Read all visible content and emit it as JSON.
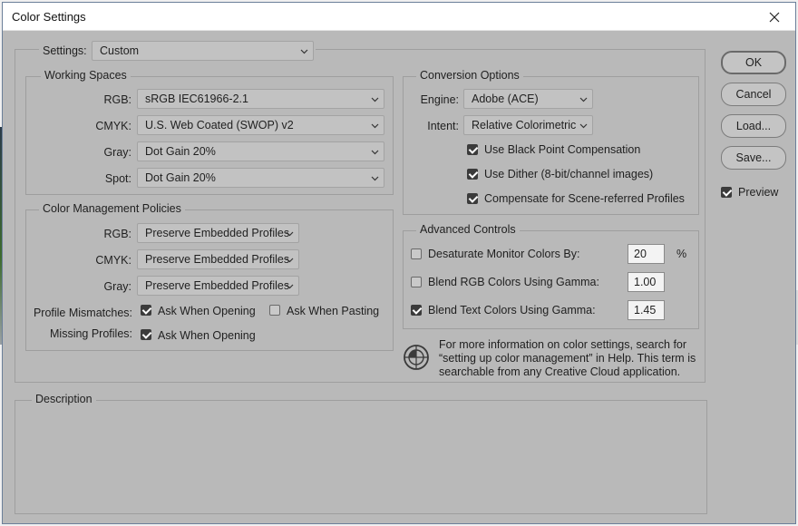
{
  "window": {
    "title": "Color Settings"
  },
  "settings": {
    "label": "Settings:",
    "value": "Custom"
  },
  "working_spaces": {
    "title": "Working Spaces",
    "rows": [
      {
        "label": "RGB:",
        "value": "sRGB IEC61966-2.1"
      },
      {
        "label": "CMYK:",
        "value": "U.S. Web Coated (SWOP) v2"
      },
      {
        "label": "Gray:",
        "value": "Dot Gain 20%"
      },
      {
        "label": "Spot:",
        "value": "Dot Gain 20%"
      }
    ]
  },
  "policies": {
    "title": "Color Management Policies",
    "rows": [
      {
        "label": "RGB:",
        "value": "Preserve Embedded Profiles"
      },
      {
        "label": "CMYK:",
        "value": "Preserve Embedded Profiles"
      },
      {
        "label": "Gray:",
        "value": "Preserve Embedded Profiles"
      }
    ],
    "profile_mismatches": {
      "label": "Profile Mismatches:",
      "ask_opening": {
        "label": "Ask When Opening",
        "checked": true
      },
      "ask_pasting": {
        "label": "Ask When Pasting",
        "checked": false
      }
    },
    "missing_profiles": {
      "label": "Missing Profiles:",
      "ask_opening": {
        "label": "Ask When Opening",
        "checked": true
      }
    }
  },
  "conversion": {
    "title": "Conversion Options",
    "engine": {
      "label": "Engine:",
      "value": "Adobe (ACE)"
    },
    "intent": {
      "label": "Intent:",
      "value": "Relative Colorimetric"
    },
    "options": [
      {
        "label": "Use Black Point Compensation",
        "checked": true
      },
      {
        "label": "Use Dither (8-bit/channel images)",
        "checked": true
      },
      {
        "label": "Compensate for Scene-referred Profiles",
        "checked": true
      }
    ]
  },
  "advanced": {
    "title": "Advanced Controls",
    "desaturate": {
      "label": "Desaturate Monitor Colors By:",
      "value": "20",
      "unit": "%",
      "checked": false
    },
    "blend_rgb": {
      "label": "Blend RGB Colors Using Gamma:",
      "value": "1.00",
      "checked": false
    },
    "blend_text": {
      "label": "Blend Text Colors Using Gamma:",
      "value": "1.45",
      "checked": true
    }
  },
  "info": {
    "icon": "color-wheel-icon",
    "lines": [
      "For more information on color settings, search for",
      "“setting up color management” in Help. This term is",
      "searchable from any Creative Cloud application."
    ]
  },
  "description": {
    "title": "Description"
  },
  "buttons": {
    "ok": "OK",
    "cancel": "Cancel",
    "load": "Load...",
    "save": "Save..."
  },
  "preview": {
    "label": "Preview",
    "checked": true
  },
  "colors": {
    "dialog_bg": "#b9b9b9",
    "titlebar_bg": "#ffffff"
  }
}
